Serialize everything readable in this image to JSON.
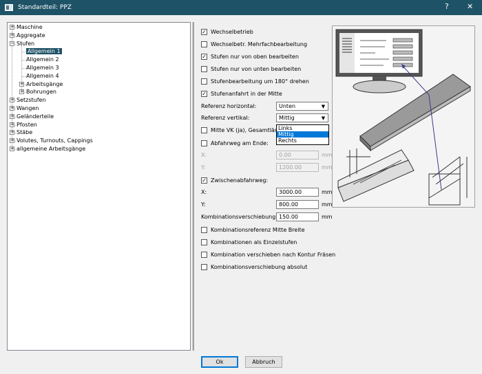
{
  "window": {
    "title": "Standardteil: PPZ",
    "help": "?",
    "close": "✕"
  },
  "tree": {
    "items": [
      {
        "label": "Maschine",
        "expander": "+"
      },
      {
        "label": "Aggregate",
        "expander": "+"
      },
      {
        "label": "Stufen",
        "expander": "−"
      },
      {
        "label": "Allgemein  1"
      },
      {
        "label": "Allgemein  2"
      },
      {
        "label": "Allgemein  3"
      },
      {
        "label": "Allgemein  4"
      },
      {
        "label": "Arbeitsgänge",
        "expander": "+"
      },
      {
        "label": "Bohrungen",
        "expander": "+"
      },
      {
        "label": "Setzstufen",
        "expander": "+"
      },
      {
        "label": "Wangen",
        "expander": "+"
      },
      {
        "label": "Geländerteile",
        "expander": "+"
      },
      {
        "label": "Pfosten",
        "expander": "+"
      },
      {
        "label": "Stäbe",
        "expander": "+"
      },
      {
        "label": "Volutes, Turnouts, Cappings",
        "expander": "+"
      },
      {
        "label": "allgemeine Arbeitsgänge",
        "expander": "+"
      }
    ]
  },
  "form": {
    "wechselbetrieb": {
      "label": "Wechselbetrieb",
      "checked": true
    },
    "mehrfach": {
      "label": "Wechselbetr. Mehrfachbearbeitung",
      "checked": false
    },
    "oben": {
      "label": "Stufen nur von oben bearbeiten",
      "checked": true
    },
    "unten": {
      "label": "Stufen nur von unten bearbeiten",
      "checked": false
    },
    "drehen": {
      "label": "Stufenbearbeitung um 180° drehen",
      "checked": false
    },
    "mitte": {
      "label": "Stufenanfahrt in der Mitte",
      "checked": true
    },
    "ref_h": {
      "label": "Referenz horizontal:",
      "value": "Unten"
    },
    "ref_v": {
      "label": "Referenz vertikal:",
      "value": "Mittig",
      "options": [
        "Links",
        "Mittig",
        "Rechts"
      ]
    },
    "mitte_vk": {
      "label": "Mitte VK (ja), Gesamtlänge",
      "checked": false
    },
    "abfahrweg": {
      "label": "Abfahrweg am Ende:",
      "checked": false
    },
    "abf_x": {
      "label": "X:",
      "value": "0.00",
      "unit": "mm"
    },
    "abf_y": {
      "label": "Y:",
      "value": "1200.00",
      "unit": "mm"
    },
    "zwischen": {
      "label": "Zwischenabfahrweg:",
      "checked": true
    },
    "zw_x": {
      "label": "X:",
      "value": "3000.00",
      "unit": "mm"
    },
    "zw_y": {
      "label": "Y:",
      "value": "800.00",
      "unit": "mm"
    },
    "komb": {
      "label": "Kombinationsverschiebung:",
      "value": "150.00",
      "unit": "mm"
    },
    "komb_ref": {
      "label": "Kombinationsreferenz Mitte Breite",
      "checked": false
    },
    "komb_einzel": {
      "label": "Kombinationen als Einzelstufen",
      "checked": false
    },
    "komb_kontur": {
      "label": "Kombination verschieben nach Kontur Fräsen",
      "checked": false
    },
    "komb_abs": {
      "label": "Kombinationsverschiebung absolut",
      "checked": false
    }
  },
  "buttons": {
    "ok": "Ok",
    "cancel": "Abbruch"
  }
}
